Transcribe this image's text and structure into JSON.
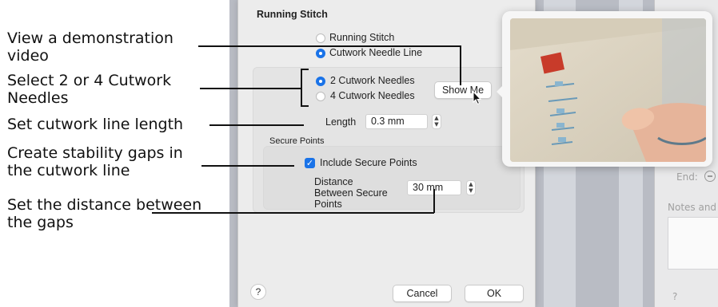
{
  "callouts": {
    "video": "View a demonstration video",
    "needles": "Select 2 or 4 Cutwork Needles",
    "length": "Set cutwork line length",
    "gaps": "Create stability gaps in the cutwork line",
    "distance": "Set the distance between the gaps"
  },
  "dialog": {
    "title": "Running Stitch",
    "stitch_options": [
      "Running Stitch",
      "Cutwork Needle Line"
    ],
    "stitch_selected": 1,
    "needle_options": [
      "2 Cutwork Needles",
      "4 Cutwork Needles"
    ],
    "needle_selected": 0,
    "show_me_label": "Show Me",
    "length_label": "Length",
    "length_value": "0.3 mm",
    "secure_section": "Secure Points",
    "include_secure_label": "Include Secure Points",
    "include_secure_checked": true,
    "distance_label": "Distance Between Secure Points",
    "distance_value": "30 mm",
    "help_label": "?",
    "cancel_label": "Cancel",
    "ok_label": "OK"
  },
  "right_panel": {
    "end_label": "End:",
    "notes_label": "Notes and",
    "help_label": "?"
  },
  "colors": {
    "accent": "#1a73e8",
    "dialog_bg": "#ececec"
  },
  "icons": [
    "pointer-cursor-icon",
    "checkmark-icon",
    "stepper-icon",
    "minus-circle-icon"
  ]
}
